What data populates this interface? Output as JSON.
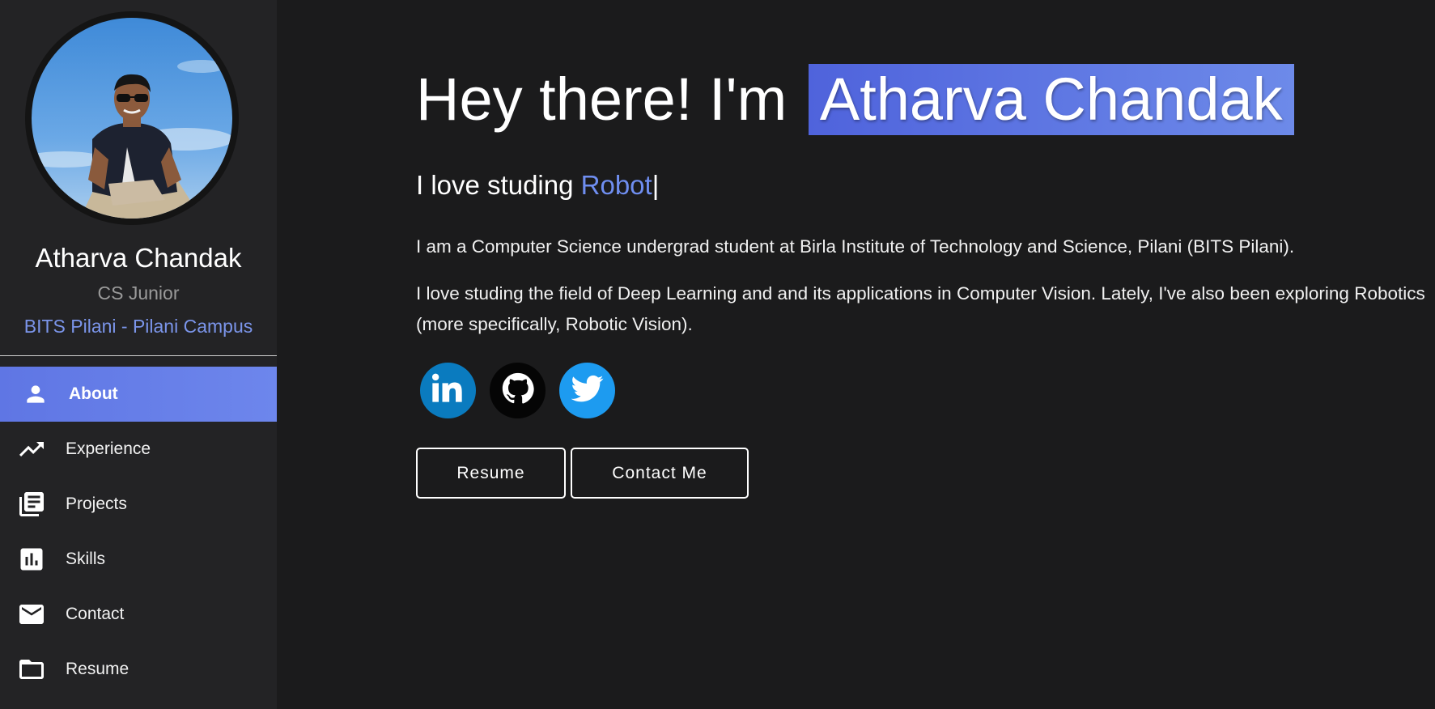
{
  "profile": {
    "name": "Atharva Chandak",
    "role": "CS Junior",
    "school": "BITS Pilani - Pilani Campus"
  },
  "nav": {
    "items": [
      {
        "label": "About",
        "icon": "person-icon",
        "active": true
      },
      {
        "label": "Experience",
        "icon": "trending-up-icon",
        "active": false
      },
      {
        "label": "Projects",
        "icon": "library-books-icon",
        "active": false
      },
      {
        "label": "Skills",
        "icon": "bar-chart-icon",
        "active": false
      },
      {
        "label": "Contact",
        "icon": "mail-icon",
        "active": false
      },
      {
        "label": "Resume",
        "icon": "folder-icon",
        "active": false
      }
    ]
  },
  "hero": {
    "greeting": "Hey there! I'm",
    "name": "Atharva Chandak",
    "typing_prefix": "I love studing",
    "typing_word": "Robot",
    "caret": "|"
  },
  "bio": {
    "paragraph1": "I am a Computer Science undergrad student at Birla Institute of Technology and Science, Pilani (BITS Pilani).",
    "paragraph2": "I love studing the field of Deep Learning and and its applications in Computer Vision. Lately, I've also been exploring Robotics (more specifically, Robotic Vision)."
  },
  "socials": [
    {
      "name": "linkedin-icon",
      "color": "#0a7bbf"
    },
    {
      "name": "github-icon",
      "color": "#050505"
    },
    {
      "name": "twitter-icon",
      "color": "#1d9bf0"
    }
  ],
  "actions": {
    "resume_label": "Resume",
    "contact_label": "Contact Me"
  },
  "colors": {
    "accent": "#6d86ec",
    "highlight": "#4f63dc",
    "link": "#7b95ea",
    "background": "#1b1b1c",
    "sidebar": "#232325"
  }
}
